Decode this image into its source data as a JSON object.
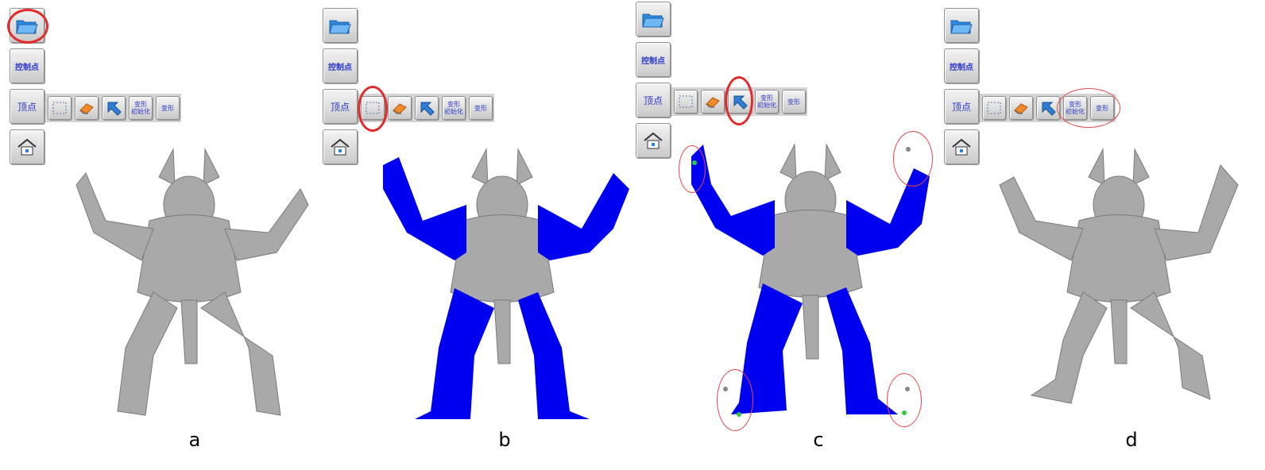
{
  "toolbar": {
    "control_points": "控制点",
    "vertex": "顶点",
    "deform_init_line1": "变形",
    "deform_init_line2": "初始化",
    "deform": "变形"
  },
  "icons": [
    "open-folder-icon",
    "select-rect-icon",
    "eraser-icon",
    "cursor-arrow-icon",
    "home-icon"
  ],
  "colors": {
    "accent": "#2b39c6",
    "highlight": "#e22b2b",
    "selection": "#0000f0",
    "mesh": "#a9a9a9",
    "control_point": "#2ecc40"
  },
  "panels": [
    {
      "caption": "a"
    },
    {
      "caption": "b"
    },
    {
      "caption": "c"
    },
    {
      "caption": "d"
    }
  ]
}
